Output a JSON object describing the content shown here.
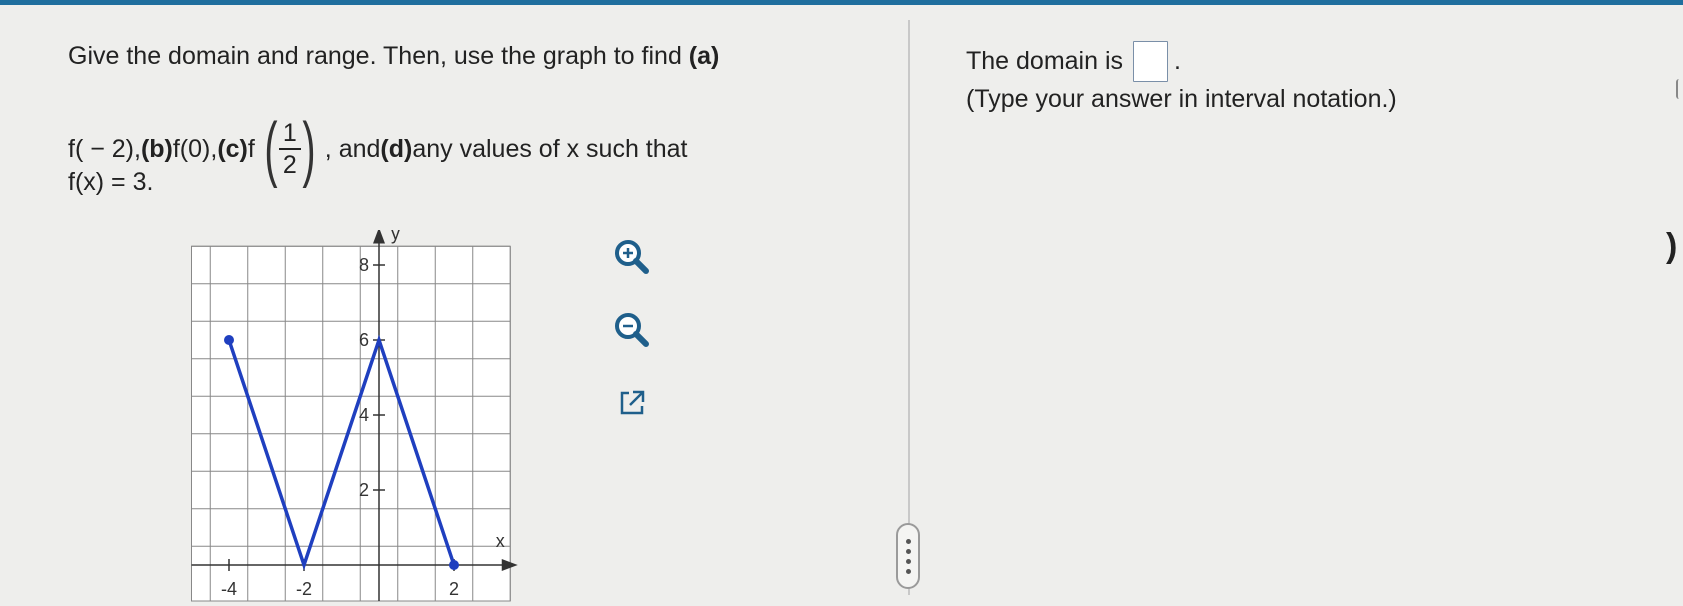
{
  "question": {
    "line1_prefix": "Give the domain and range. Then, use the graph to find ",
    "part_a_label": "(a)",
    "line2_fn_a": "f( − 2), ",
    "part_b_label": "(b)",
    "line2_fn_b": " f(0), ",
    "part_c_label": "(c)",
    "line2_fn_c": " f",
    "frac_num": "1",
    "frac_den": "2",
    "line2_after_frac": ", and ",
    "part_d_label": "(d)",
    "line2_tail": " any values of x such that",
    "line3": "f(x) = 3."
  },
  "answer": {
    "domain_prefix": "The domain is",
    "domain_suffix": ".",
    "hint": "(Type your answer in interval notation.)"
  },
  "tools": {
    "zoom_in": "zoom-in-icon",
    "zoom_out": "zoom-out-icon",
    "open_new": "external-link-icon"
  },
  "chart_data": {
    "type": "line",
    "xlabel": "x",
    "ylabel": "y",
    "xlim": [
      -5,
      3.7
    ],
    "ylim": [
      -0.5,
      9
    ],
    "x_ticks": [
      -4,
      -2,
      2
    ],
    "y_ticks": [
      2,
      4,
      6,
      8
    ],
    "grid": true,
    "series": [
      {
        "x": [
          -4,
          -2,
          0,
          2
        ],
        "y": [
          6,
          0,
          6,
          0
        ],
        "color": "#1f3fbf",
        "endpoints": [
          [
            -4,
            6
          ],
          [
            2,
            0
          ]
        ]
      }
    ]
  }
}
